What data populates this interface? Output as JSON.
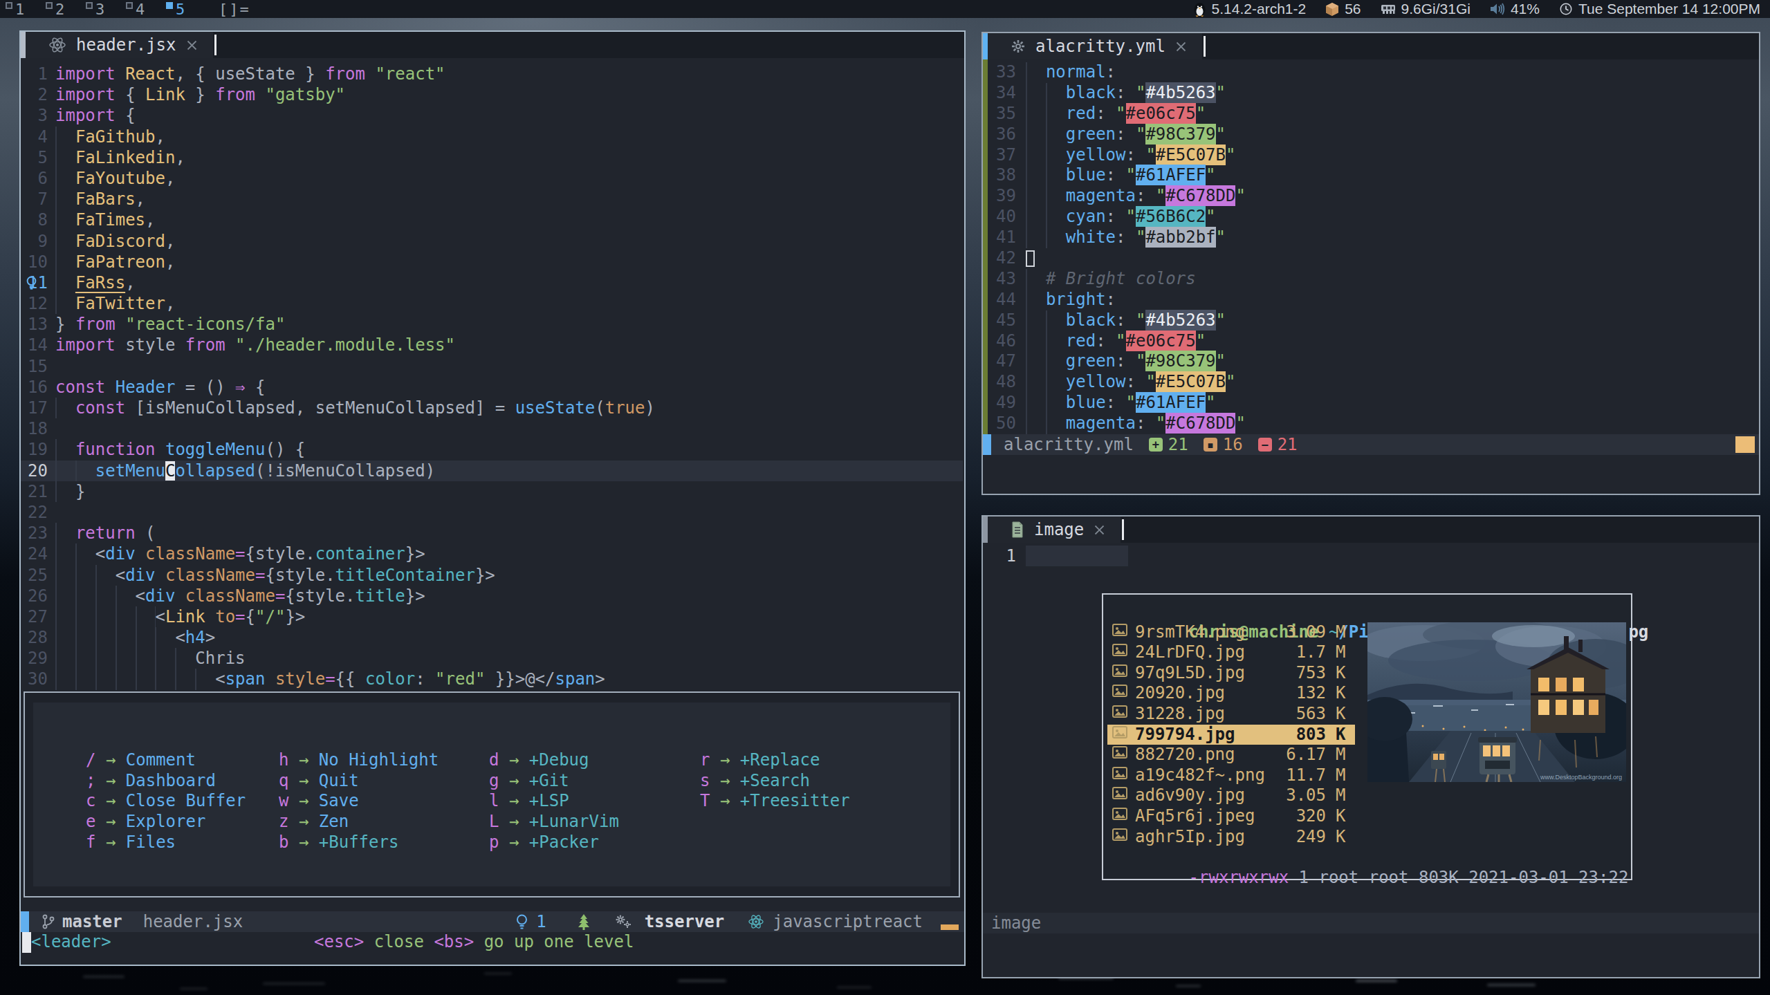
{
  "topbar": {
    "workspaces": [
      "1",
      "2",
      "3",
      "4",
      "5"
    ],
    "active_workspace": "5",
    "layout_indicator": "[]=",
    "status_modules": [
      {
        "icon": "penguin-icon",
        "text": "5.14.2-arch1-2"
      },
      {
        "icon": "package-icon",
        "text": "56"
      },
      {
        "icon": "memory-icon",
        "text": "9.6Gi/31Gi"
      },
      {
        "icon": "volume-icon",
        "text": "41%"
      },
      {
        "icon": "clock-icon",
        "text": "Tue September 14 12:00PM"
      }
    ]
  },
  "editor_left": {
    "tab": {
      "icon": "react-icon",
      "title": "header.jsx"
    },
    "lines": [
      {
        "n": "1",
        "t": [
          [
            "k",
            "import "
          ],
          [
            "t",
            "React"
          ],
          [
            "d",
            ", { useState } "
          ],
          [
            "k",
            "from "
          ],
          [
            "s",
            "\"react\""
          ]
        ]
      },
      {
        "n": "2",
        "t": [
          [
            "k",
            "import "
          ],
          [
            "d",
            "{ "
          ],
          [
            "t",
            "Link"
          ],
          [
            "d",
            " } "
          ],
          [
            "k",
            "from "
          ],
          [
            "s",
            "\"gatsby\""
          ]
        ]
      },
      {
        "n": "3",
        "t": [
          [
            "k",
            "import "
          ],
          [
            "d",
            "{"
          ]
        ]
      },
      {
        "n": "4",
        "ind": 2,
        "t": [
          [
            "t",
            "FaGithub"
          ],
          [
            "d",
            ","
          ]
        ]
      },
      {
        "n": "5",
        "ind": 2,
        "t": [
          [
            "t",
            "FaLinkedin"
          ],
          [
            "d",
            ","
          ]
        ]
      },
      {
        "n": "6",
        "ind": 2,
        "t": [
          [
            "t",
            "FaYoutube"
          ],
          [
            "d",
            ","
          ]
        ]
      },
      {
        "n": "7",
        "ind": 2,
        "t": [
          [
            "t",
            "FaBars"
          ],
          [
            "d",
            ","
          ]
        ]
      },
      {
        "n": "8",
        "ind": 2,
        "t": [
          [
            "t",
            "FaTimes"
          ],
          [
            "d",
            ","
          ]
        ]
      },
      {
        "n": "9",
        "ind": 2,
        "t": [
          [
            "t",
            "FaDiscord"
          ],
          [
            "d",
            ","
          ]
        ]
      },
      {
        "n": "10",
        "ind": 2,
        "t": [
          [
            "t",
            "FaPatreon"
          ],
          [
            "d",
            ","
          ]
        ]
      },
      {
        "n": "11",
        "ind": 2,
        "numcls": "blue",
        "bulb": true,
        "t": [
          [
            "t u",
            "FaRss"
          ],
          [
            "d",
            ","
          ]
        ]
      },
      {
        "n": "12",
        "ind": 2,
        "t": [
          [
            "t",
            "FaTwitter"
          ],
          [
            "d",
            ","
          ]
        ]
      },
      {
        "n": "13",
        "t": [
          [
            "d",
            "} "
          ],
          [
            "k",
            "from "
          ],
          [
            "s",
            "\"react-icons/fa\""
          ]
        ]
      },
      {
        "n": "14",
        "t": [
          [
            "k",
            "import "
          ],
          [
            "d",
            "style "
          ],
          [
            "k",
            "from "
          ],
          [
            "s",
            "\"./header.module.less\""
          ]
        ]
      },
      {
        "n": "15",
        "t": []
      },
      {
        "n": "16",
        "t": [
          [
            "k",
            "const "
          ],
          [
            "f",
            "Header"
          ],
          [
            "d",
            " = () "
          ],
          [
            "k",
            "⇒"
          ],
          [
            "d",
            " {"
          ]
        ]
      },
      {
        "n": "17",
        "ind": 2,
        "t": [
          [
            "k",
            "const "
          ],
          [
            "d",
            "[isMenuCollapsed, setMenuCollapsed] = "
          ],
          [
            "f",
            "useState"
          ],
          [
            "d",
            "("
          ],
          [
            "b",
            "true"
          ],
          [
            "d",
            ")"
          ]
        ]
      },
      {
        "n": "18",
        "t": []
      },
      {
        "n": "19",
        "ind": 2,
        "t": [
          [
            "k",
            "function "
          ],
          [
            "f",
            "toggleMenu"
          ],
          [
            "d",
            "() {"
          ]
        ]
      },
      {
        "n": "20",
        "ind": 4,
        "cl": true,
        "numcls": "cur-num",
        "t": [
          [
            "f",
            "setMenu"
          ],
          [
            "f cur",
            "C"
          ],
          [
            "f",
            "ollapsed"
          ],
          [
            "d",
            "(!isMenuCollapsed)"
          ]
        ]
      },
      {
        "n": "21",
        "ind": 2,
        "t": [
          [
            "d",
            "}"
          ]
        ]
      },
      {
        "n": "22",
        "t": []
      },
      {
        "n": "23",
        "ind": 2,
        "t": [
          [
            "k",
            "return"
          ],
          [
            "d",
            " ("
          ]
        ]
      },
      {
        "n": "24",
        "ind": 4,
        "t": [
          [
            "d",
            "<"
          ],
          [
            "f",
            "div"
          ],
          [
            "d",
            " "
          ],
          [
            "o",
            "className"
          ],
          [
            "k",
            "="
          ],
          [
            "d",
            "{style."
          ],
          [
            "tl",
            "container"
          ],
          [
            "d",
            "}>"
          ]
        ]
      },
      {
        "n": "25",
        "ind": 6,
        "t": [
          [
            "d",
            "<"
          ],
          [
            "f",
            "div"
          ],
          [
            "d",
            " "
          ],
          [
            "o",
            "className"
          ],
          [
            "k",
            "="
          ],
          [
            "d",
            "{style."
          ],
          [
            "tl",
            "titleContainer"
          ],
          [
            "d",
            "}>"
          ]
        ]
      },
      {
        "n": "26",
        "ind": 8,
        "t": [
          [
            "d",
            "<"
          ],
          [
            "f",
            "div"
          ],
          [
            "d",
            " "
          ],
          [
            "o",
            "className"
          ],
          [
            "k",
            "="
          ],
          [
            "d",
            "{style."
          ],
          [
            "tl",
            "title"
          ],
          [
            "d",
            "}>"
          ]
        ]
      },
      {
        "n": "27",
        "ind": 10,
        "t": [
          [
            "d",
            "<"
          ],
          [
            "t",
            "Link"
          ],
          [
            "d",
            " "
          ],
          [
            "o",
            "to"
          ],
          [
            "k",
            "="
          ],
          [
            "d",
            "{"
          ],
          [
            "s",
            "\"/\""
          ],
          [
            "d",
            "}>"
          ]
        ]
      },
      {
        "n": "28",
        "ind": 12,
        "t": [
          [
            "d",
            "<"
          ],
          [
            "f",
            "h4"
          ],
          [
            "d",
            ">"
          ]
        ]
      },
      {
        "n": "29",
        "ind": 14,
        "t": [
          [
            "d",
            "Chris"
          ]
        ]
      },
      {
        "n": "30",
        "ind": 16,
        "t": [
          [
            "d",
            "<"
          ],
          [
            "f",
            "span"
          ],
          [
            "d",
            " "
          ],
          [
            "o",
            "style"
          ],
          [
            "k",
            "="
          ],
          [
            "d",
            "{{ "
          ],
          [
            "tl",
            "color"
          ],
          [
            "d",
            ": "
          ],
          [
            "s",
            "\"red\""
          ],
          [
            "d",
            " }}>@</"
          ],
          [
            "f",
            "span"
          ],
          [
            "d",
            ">"
          ]
        ]
      }
    ],
    "whichkey": {
      "columns": [
        [
          {
            "key": "/",
            "label": "Comment"
          },
          {
            "key": ";",
            "label": "Dashboard"
          },
          {
            "key": "c",
            "label": "Close Buffer"
          },
          {
            "key": "e",
            "label": "Explorer"
          },
          {
            "key": "f",
            "label": "Files"
          }
        ],
        [
          {
            "key": "h",
            "label": "No Highlight"
          },
          {
            "key": "q",
            "label": "Quit"
          },
          {
            "key": "w",
            "label": "Save"
          },
          {
            "key": "z",
            "label": "Zen"
          },
          {
            "key": "b",
            "label": "+Buffers"
          }
        ],
        [
          {
            "key": "d",
            "label": "+Debug"
          },
          {
            "key": "g",
            "label": "+Git"
          },
          {
            "key": "l",
            "label": "+LSP"
          },
          {
            "key": "L",
            "label": "+LunarVim"
          },
          {
            "key": "p",
            "label": "+Packer"
          }
        ],
        [
          {
            "key": "r",
            "label": "+Replace"
          },
          {
            "key": "s",
            "label": "+Search"
          },
          {
            "key": "T",
            "label": "+Treesitter"
          }
        ]
      ]
    },
    "statusline": {
      "branch": "master",
      "file": "header.jsx",
      "diag_count": "1",
      "lsp": "tsserver",
      "filetype": "javascriptreact"
    },
    "cmdline": {
      "leader": "<leader>",
      "hints": [
        [
          "<esc>",
          "k"
        ],
        [
          " close ",
          "d"
        ],
        [
          "<bs>",
          "k"
        ],
        [
          " go up one level",
          "d"
        ]
      ]
    }
  },
  "editor_topright": {
    "tab": {
      "icon": "gear-icon",
      "title": "alacritty.yml"
    },
    "lines": [
      {
        "n": "33",
        "ind": 2,
        "t": [
          [
            "f",
            "normal"
          ],
          [
            "d",
            ":"
          ]
        ]
      },
      {
        "n": "34",
        "ind": 4,
        "t": [
          [
            "f",
            "black"
          ],
          [
            "d",
            ": "
          ],
          [
            "s",
            "\""
          ],
          [
            "sw sw1",
            "#4b5263"
          ],
          [
            "s",
            "\""
          ]
        ]
      },
      {
        "n": "35",
        "ind": 4,
        "t": [
          [
            "f",
            "red"
          ],
          [
            "d",
            ": "
          ],
          [
            "s",
            "\""
          ],
          [
            "sw sw2",
            "#e06c75"
          ],
          [
            "s",
            "\""
          ]
        ]
      },
      {
        "n": "36",
        "ind": 4,
        "t": [
          [
            "f",
            "green"
          ],
          [
            "d",
            ": "
          ],
          [
            "s",
            "\""
          ],
          [
            "sw sw3",
            "#98C379"
          ],
          [
            "s",
            "\""
          ]
        ]
      },
      {
        "n": "37",
        "ind": 4,
        "t": [
          [
            "f",
            "yellow"
          ],
          [
            "d",
            ": "
          ],
          [
            "s",
            "\""
          ],
          [
            "sw sw4",
            "#E5C07B"
          ],
          [
            "s",
            "\""
          ]
        ]
      },
      {
        "n": "38",
        "ind": 4,
        "t": [
          [
            "f",
            "blue"
          ],
          [
            "d",
            ": "
          ],
          [
            "s",
            "\""
          ],
          [
            "sw sw5",
            "#61AFEF"
          ],
          [
            "s",
            "\""
          ]
        ]
      },
      {
        "n": "39",
        "ind": 4,
        "t": [
          [
            "f",
            "magenta"
          ],
          [
            "d",
            ": "
          ],
          [
            "s",
            "\""
          ],
          [
            "sw sw6",
            "#C678DD"
          ],
          [
            "s",
            "\""
          ]
        ]
      },
      {
        "n": "40",
        "ind": 4,
        "t": [
          [
            "f",
            "cyan"
          ],
          [
            "d",
            ": "
          ],
          [
            "s",
            "\""
          ],
          [
            "sw sw7",
            "#56B6C2"
          ],
          [
            "s",
            "\""
          ]
        ]
      },
      {
        "n": "41",
        "ind": 4,
        "t": [
          [
            "f",
            "white"
          ],
          [
            "d",
            ": "
          ],
          [
            "s",
            "\""
          ],
          [
            "sw sw8",
            "#abb2bf"
          ],
          [
            "s",
            "\""
          ]
        ]
      },
      {
        "n": "42",
        "hollow": true,
        "t": []
      },
      {
        "n": "43",
        "ind": 2,
        "t": [
          [
            "c",
            "# Bright colors"
          ]
        ]
      },
      {
        "n": "44",
        "ind": 2,
        "t": [
          [
            "f",
            "bright"
          ],
          [
            "d",
            ":"
          ]
        ]
      },
      {
        "n": "45",
        "ind": 4,
        "t": [
          [
            "f",
            "black"
          ],
          [
            "d",
            ": "
          ],
          [
            "s",
            "\""
          ],
          [
            "sw sw1",
            "#4b5263"
          ],
          [
            "s",
            "\""
          ]
        ]
      },
      {
        "n": "46",
        "ind": 4,
        "t": [
          [
            "f",
            "red"
          ],
          [
            "d",
            ": "
          ],
          [
            "s",
            "\""
          ],
          [
            "sw sw2",
            "#e06c75"
          ],
          [
            "s",
            "\""
          ]
        ]
      },
      {
        "n": "47",
        "ind": 4,
        "t": [
          [
            "f",
            "green"
          ],
          [
            "d",
            ": "
          ],
          [
            "s",
            "\""
          ],
          [
            "sw sw3",
            "#98C379"
          ],
          [
            "s",
            "\""
          ]
        ]
      },
      {
        "n": "48",
        "ind": 4,
        "t": [
          [
            "f",
            "yellow"
          ],
          [
            "d",
            ": "
          ],
          [
            "s",
            "\""
          ],
          [
            "sw sw4",
            "#E5C07B"
          ],
          [
            "s",
            "\""
          ]
        ]
      },
      {
        "n": "49",
        "ind": 4,
        "t": [
          [
            "f",
            "blue"
          ],
          [
            "d",
            ": "
          ],
          [
            "s",
            "\""
          ],
          [
            "sw sw5",
            "#61AFEF"
          ],
          [
            "s",
            "\""
          ]
        ]
      },
      {
        "n": "50",
        "ind": 4,
        "t": [
          [
            "f",
            "magenta"
          ],
          [
            "d",
            ": "
          ],
          [
            "s",
            "\""
          ],
          [
            "sw sw6",
            "#C678DD"
          ],
          [
            "s",
            "\""
          ]
        ]
      }
    ],
    "statusline": {
      "file": "alacritty.yml",
      "added": "21",
      "changed": "16",
      "removed": "21"
    }
  },
  "editor_bottomright": {
    "tab": {
      "icon": "file-icon",
      "title": "image"
    },
    "line_number": "1",
    "terminal": {
      "prompt_user": "chris@machine",
      "prompt_tilde": "~",
      "prompt_path": "/Pictures/wallpapers/",
      "prompt_file": "799794.jpg",
      "files": [
        {
          "name": "9rsmTK4.png",
          "size": "3.09",
          "unit": "M"
        },
        {
          "name": "24LrDFQ.jpg",
          "size": "1.7",
          "unit": "M"
        },
        {
          "name": "97q9L5D.jpg",
          "size": "753",
          "unit": "K"
        },
        {
          "name": "20920.jpg",
          "size": "132",
          "unit": "K"
        },
        {
          "name": "31228.jpg",
          "size": "563",
          "unit": "K"
        },
        {
          "name": "799794.jpg",
          "size": "803",
          "unit": "K",
          "selected": true
        },
        {
          "name": "882720.png",
          "size": "6.17",
          "unit": "M"
        },
        {
          "name": "a19c482f~.png",
          "size": "11.7",
          "unit": "M"
        },
        {
          "name": "ad6v90y.jpg",
          "size": "3.05",
          "unit": "M"
        },
        {
          "name": "AFq5r6j.jpeg",
          "size": "320",
          "unit": "K"
        },
        {
          "name": "aghr5Ip.jpg",
          "size": "249",
          "unit": "K"
        }
      ],
      "perm_prefix": "-rwxrwxrwx",
      "perm_rest": " 1 root root 803K 2021-03-01 23:22",
      "watermark": "www.DesktopBackground.org"
    },
    "statusline": {
      "file": "image"
    }
  },
  "colors": {
    "accent_blue": "#61afef",
    "green": "#98c379",
    "magenta": "#c678dd",
    "teal": "#56b6c2",
    "orange": "#d19a66",
    "yellow": "#e5c07b",
    "red": "#e06c75",
    "fg": "#abb2bf",
    "bg": "#21252d"
  }
}
